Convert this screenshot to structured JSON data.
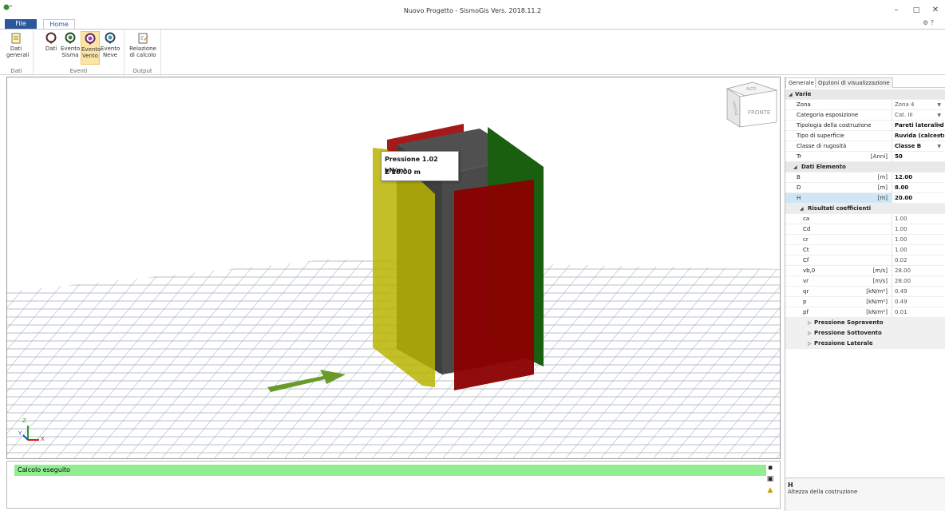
{
  "window": {
    "title": "Nuovo Progetto - SismoGis Vers. 2018.11.2",
    "minimize": "–",
    "maximize": "□",
    "close": "✕"
  },
  "ribbon": {
    "tabs": {
      "file": "File",
      "home": "Home"
    },
    "groups": {
      "dati": {
        "label": "Dati",
        "buttons": [
          {
            "label": "Dati generali",
            "icon": "notepad-icon"
          }
        ]
      },
      "eventi": {
        "label": "Eventi",
        "buttons": [
          {
            "label": "Dati",
            "icon": "map-pin-icon"
          },
          {
            "label": "Evento Sisma",
            "icon": "seismic-pin-icon"
          },
          {
            "label": "Evento Vento",
            "icon": "wind-pin-icon",
            "active": true
          },
          {
            "label": "Evento Neve",
            "icon": "snow-pin-icon"
          }
        ]
      },
      "output": {
        "label": "Output",
        "buttons": [
          {
            "label": "Relazione di calcolo",
            "icon": "report-icon"
          }
        ]
      }
    }
  },
  "viewport": {
    "tooltip": {
      "line1": "Pressione 1.02 kN/m²",
      "line2": "Z 20.00 m"
    },
    "navcube": {
      "front": "FRONTE",
      "left": "SINISTRA",
      "top": "ALTO"
    },
    "axes": {
      "x": "X",
      "y": "Y",
      "z": "Z"
    },
    "colors": {
      "yellow": "#b8b400",
      "red": "#8b0000",
      "green": "#1a5e10",
      "body": "#4a4a4a",
      "arrow": "#6a9a2a"
    }
  },
  "output": {
    "status": "Calcolo eseguito",
    "status_color": "#90ee90"
  },
  "properties": {
    "tabs": {
      "general": "Generale",
      "display": "Opzioni di visualizzazione"
    },
    "varie": {
      "title": "Varie",
      "rows": [
        {
          "label": "Zona",
          "unit": "",
          "value": "Zona 4",
          "dropdown": true,
          "bold": false
        },
        {
          "label": "Categoria esposizione",
          "unit": "",
          "value": "Cat. III",
          "dropdown": true,
          "bold": false
        },
        {
          "label": "Tipologia della costruzione",
          "unit": "",
          "value": "Pareti laterali di E",
          "dropdown": true,
          "bold": true
        },
        {
          "label": "Tipo di superficie",
          "unit": "",
          "value": "Ruvida (calcestruz",
          "dropdown": true,
          "bold": true
        },
        {
          "label": "Classe di rugosità",
          "unit": "",
          "value": "Classe B",
          "dropdown": true,
          "bold": true
        },
        {
          "label": "Tr",
          "unit": "[Anni]",
          "value": "50",
          "dropdown": false,
          "bold": true
        }
      ]
    },
    "elemento": {
      "title": "Dati Elemento",
      "rows": [
        {
          "label": "B",
          "unit": "[m]",
          "value": "12.00"
        },
        {
          "label": "D",
          "unit": "[m]",
          "value": "8.00"
        },
        {
          "label": "H",
          "unit": "[m]",
          "value": "20.00",
          "selected": true
        }
      ]
    },
    "coefficienti": {
      "title": "Risultati coefficienti",
      "rows": [
        {
          "label": "ca",
          "unit": "",
          "value": "1.00"
        },
        {
          "label": "Cd",
          "unit": "",
          "value": "1.00"
        },
        {
          "label": "cr",
          "unit": "",
          "value": "1.00"
        },
        {
          "label": "Ct",
          "unit": "",
          "value": "1.00"
        },
        {
          "label": "Cf",
          "unit": "",
          "value": "0.02"
        },
        {
          "label": "vb,0",
          "unit": "[m/s]",
          "value": "28.00"
        },
        {
          "label": "vr",
          "unit": "[m/s]",
          "value": "28.00"
        },
        {
          "label": "qr",
          "unit": "[kN/m²]",
          "value": "0.49"
        },
        {
          "label": "p",
          "unit": "[kN/m²]",
          "value": "0.49"
        },
        {
          "label": "pf",
          "unit": "[kN/m²]",
          "value": "0.01"
        }
      ]
    },
    "collapsed": [
      "Pressione Sopravento",
      "Pressione Sottovento",
      "Pressione Laterale"
    ],
    "description": {
      "title": "H",
      "text": "Altezza della costruzione"
    }
  }
}
